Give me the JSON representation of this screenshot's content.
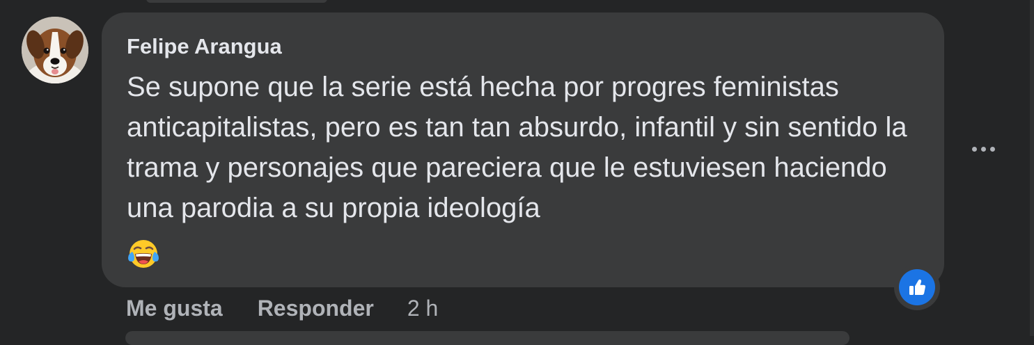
{
  "comment": {
    "author": "Felipe Arangua",
    "text": "Se supone que la serie está hecha por progres feministas anticapitalistas, pero es tan tan absurdo, infantil y sin sentido la trama y personajes que pareciera que le estuviesen haciendo una parodia a su propia ideología",
    "emoji": "face-with-tears-of-joy",
    "reaction": "like",
    "actions": {
      "like_label": "Me gusta",
      "reply_label": "Responder",
      "time": "2 h"
    }
  },
  "icons": {
    "more": "more-options-icon",
    "reaction": "thumbs-up-icon"
  },
  "colors": {
    "background": "#242526",
    "bubble": "#3a3b3c",
    "primary_text": "#e4e6eb",
    "secondary_text": "#b0b3b8",
    "like_blue": "#1b74e4"
  }
}
